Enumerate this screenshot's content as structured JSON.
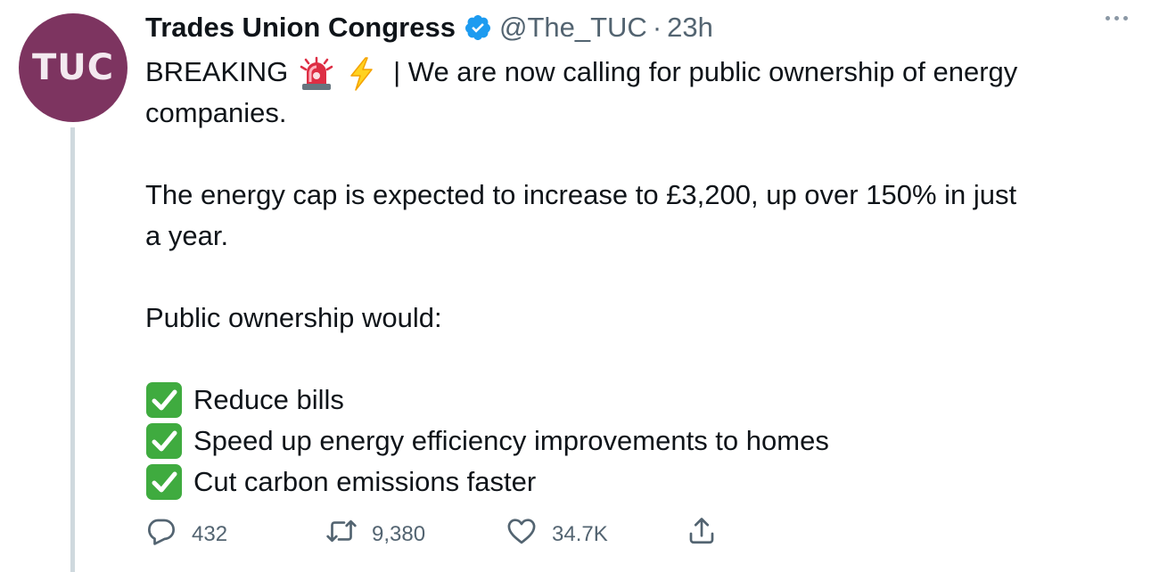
{
  "tweet": {
    "avatar_text": "TUC",
    "author_name": "Trades Union Congress",
    "handle": "@The_TUC",
    "separator": "·",
    "time": "23h",
    "line1_prefix": "BREAKING",
    "line1_suffix": "| We are now calling for public ownership of energy",
    "line2": "companies.",
    "para2_line1": "The energy cap is expected to increase to £3,200, up over 150% in just",
    "para2_line2": "a year.",
    "para3": "Public ownership would:",
    "checklist": [
      "Reduce bills",
      "Speed up energy efficiency improvements to homes",
      "Cut carbon emissions faster"
    ]
  },
  "actions": {
    "replies": "432",
    "retweets": "9,380",
    "likes": "34.7K"
  },
  "icons": {
    "verified": "verified-badge-icon",
    "siren": "police-light-icon",
    "lightning": "high-voltage-icon",
    "check": "check-mark-button-icon",
    "reply": "reply-icon",
    "retweet": "retweet-icon",
    "like": "heart-icon",
    "share": "share-icon",
    "more": "more-icon"
  },
  "colors": {
    "avatar_bg": "#7d3460",
    "verified": "#1d9bf0",
    "text": "#0f1419",
    "muted": "#536471",
    "check_green": "#3fab3f",
    "thread_line": "#cfd9de"
  }
}
